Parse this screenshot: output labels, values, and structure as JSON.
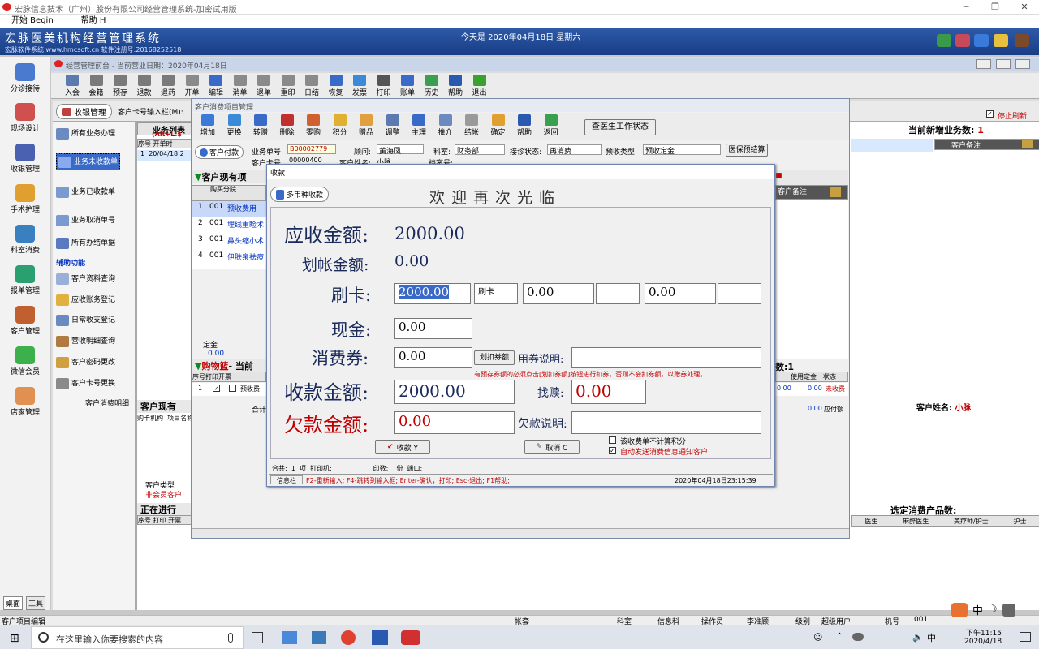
{
  "app": {
    "window_title": "宏脉信息技术（广州）股份有限公司经营管理系统-加密试用版",
    "menu": [
      "开始 Begin",
      "帮助 H"
    ],
    "banner_name": "宏脉医美机构经营管理系统",
    "banner_sub": "宏脉软件系统  www.hmcsoft.cn  软件注册号:20168252518",
    "banner_date": "今天是  2020年04月18日    星期六"
  },
  "left_nav": [
    "分诊接待",
    "现场设计",
    "收银管理",
    "手术护理",
    "科室消费",
    "报单管理",
    "客户管理",
    "微信会员",
    "店家管理"
  ],
  "bottom_tabs": [
    "桌面",
    "工具"
  ],
  "child_window": {
    "title": "经营管理前台 - 当前营业日期：2020年04月18日"
  },
  "toolbar1": [
    "入会",
    "会籍",
    "预存",
    "退款",
    "退药",
    "开单",
    "编辑",
    "消单",
    "退单",
    "重印",
    "日结",
    "恢复",
    "发票",
    "打印",
    "账单",
    "历史",
    "帮助",
    "退出"
  ],
  "cashier": {
    "label": "收银管理",
    "card_input_label": "客户卡号输入栏(M):",
    "stop_refresh": "停止刷新",
    "new_count_label": "当前新增业务数:",
    "new_count": "1",
    "customer_note_col": "客户备注",
    "customer_name_label": "客户姓名:",
    "customer_name": "小脉"
  },
  "side_panel": {
    "items": [
      "所有业务办理",
      "业务未收款单",
      "业务已收款单",
      "业务取消单号",
      "所有办结单据"
    ],
    "section": "辅助功能",
    "aux": [
      "客户资料查询",
      "应收账务登记",
      "日常收支登记",
      "营收明细查询",
      "客户密码更改",
      "客户卡号更换",
      "客户消费明细"
    ],
    "customer_type_label": "客户类型",
    "customer_type": "非会员客户"
  },
  "list1": {
    "title": "业务列表",
    "hint": "(Alt+L:$",
    "headers": [
      "序号",
      "开单时"
    ],
    "row": [
      "1",
      "20/04/18 2"
    ]
  },
  "consume_window": {
    "title": "客户消费项目管理",
    "toolbar": [
      "增加",
      "更换",
      "转赠",
      "删除",
      "零购",
      "积分",
      "赠品",
      "调整",
      "主理",
      "推介",
      "结帐",
      "确定",
      "帮助",
      "返回"
    ],
    "doctor_status_btn": "查医生工作状态",
    "pay_btn": "客户付款",
    "order_no_label": "业务单号:",
    "order_no": "B00002779",
    "consultant_label": "顾问:",
    "consultant": "黄海凤",
    "dept_label": "科室:",
    "dept": "财务部",
    "diag_label": "接诊状态:",
    "diag": "再消费",
    "prepay_label": "预收类型:",
    "prepay": "预收定金",
    "insurance_btn": "医保预结算",
    "card_no_label": "客户卡号:",
    "card_no": "00000400",
    "cust_name_label": "客户姓名:",
    "cust_name": "小脉",
    "file_label": "档案号:",
    "items_title": "客户现有项",
    "items_headers": [
      "购买分院"
    ],
    "items": [
      {
        "no": "1",
        "branch": "001",
        "name": "预收费用"
      },
      {
        "no": "2",
        "branch": "001",
        "name": "埋线重睑术"
      },
      {
        "no": "3",
        "branch": "001",
        "name": "鼻头缩小术"
      },
      {
        "no": "4",
        "branch": "001",
        "name": "伊肤泉祛痘"
      }
    ],
    "deposit_label": "定金",
    "deposit": "0.00",
    "cart_title": "购物篮",
    "cart_title2": "- 当前",
    "cart_headers": [
      "序号",
      "打印",
      "开票"
    ],
    "cart_row": [
      "1",
      "",
      "",
      "预收费"
    ],
    "total_label": "合计",
    "right_headers": [
      "使用定金",
      "状态"
    ],
    "right_row": [
      "0.00",
      "0.00",
      "未收费"
    ],
    "right_total": [
      "0.00",
      "应付额"
    ],
    "cust_note": "客户备注",
    "count_label": "数:1"
  },
  "lower": {
    "existing_title": "客户现有",
    "existing_headers": [
      "购卡机构",
      "项目名称"
    ],
    "in_progress_title": "正在进行",
    "in_progress_headers": [
      "序号",
      "打印",
      "开票"
    ],
    "selected_label": "选定消费产品数:",
    "staff_headers": [
      "医生",
      "麻醉医生",
      "美疗师/护士",
      "护士"
    ]
  },
  "dialog": {
    "title": "收款",
    "multi_currency_btn": "多币种收款",
    "welcome": "欢迎再次光临",
    "receivable_label": "应收金额:",
    "receivable": "2000.00",
    "charge_label": "划帐金额:",
    "charge": "0.00",
    "card_label": "刷卡:",
    "card_value": "2000.00",
    "card_type": "刷卡",
    "card_value2": "0.00",
    "card_value3": "0.00",
    "cash_label": "现金:",
    "cash": "0.00",
    "voucher_label": "消费券:",
    "voucher": "0.00",
    "voucher_btn": "划扣券额",
    "voucher_note_label": "用券说明:",
    "voucher_hint": "有预存券额的必须点击[划扣券额]按钮进行扣券，否则不会扣券额，以赠券处理。",
    "collected_label": "收款金额:",
    "collected": "2000.00",
    "change_label": "找赎:",
    "change": "0.00",
    "owed_label": "欠款金额:",
    "owed": "0.00",
    "owed_note_label": "欠款说明:",
    "ok_btn": "收款 Y",
    "cancel_btn": "取消 C",
    "chk_no_points": "该收费单不计算积分",
    "chk_notify": "自动发送消费信息通知客户",
    "status1": "合共:  1  项  打印机:                    印数:    份  端口:",
    "info_label": "信息栏",
    "info_text": "F2-重新输入; F4-跳转到输入框; Enter-确认，打印; Esc-退出; F1帮助;",
    "datetime": "2020年04月18日23:15:39"
  },
  "status_bottom": {
    "left": "客户项目编辑",
    "account_label": "帐套",
    "dept_label": "科室",
    "dept": "信息科",
    "operator_label": "操作员",
    "operator": "李准顾",
    "level_label": "级别",
    "level": "超级用户",
    "machine_label": "机号",
    "machine": "001"
  },
  "taskbar": {
    "search_placeholder": "在这里输入你要搜索的内容",
    "time": "下午11:15",
    "date": "2020/4/18",
    "ime": "中"
  }
}
